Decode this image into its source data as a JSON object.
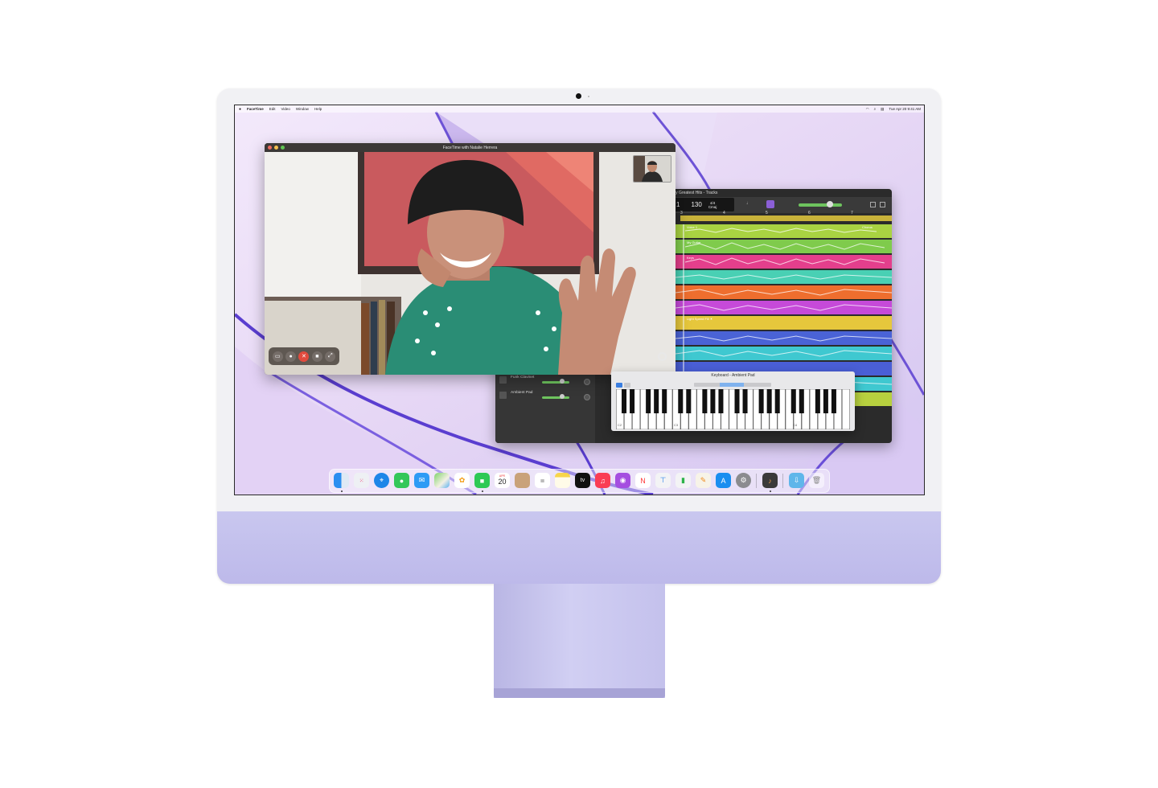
{
  "menubar": {
    "apple": "",
    "items": [
      "FaceTime",
      "Edit",
      "Video",
      "Window",
      "Help"
    ],
    "datetime": "Tue Apr 20  9:41 AM"
  },
  "facetime": {
    "title": "FaceTime with Natalie Herrera"
  },
  "garageband": {
    "title": "My Greatest Hits - Tracks",
    "lcd": {
      "bar": "1",
      "tempo": "130",
      "signature": "4/4",
      "key": "Cmaj"
    },
    "ruler": [
      "3",
      "4",
      "5",
      "6",
      "7"
    ],
    "track_labels": {
      "vocal": "Voice 1",
      "guitar": "My Guitar",
      "keys": "Keys",
      "light": "Light Speed Fill ☀",
      "chorus": "Chorus"
    },
    "tracks": [
      "Funk Clavinet",
      "Ambient Pad"
    ]
  },
  "keyboard": {
    "title": "Keyboard - Ambient Pad",
    "octaves": [
      "C2",
      "C3",
      "C4"
    ]
  },
  "calendar": {
    "month": "APR",
    "day": "20"
  },
  "appletv": "tv",
  "colors": {
    "track_colors": [
      "#a9d342",
      "#7fcb4c",
      "#5fce6a",
      "#e43f8c",
      "#49d0b4",
      "#ee6e2e",
      "#c64ad9",
      "#e6c73c",
      "#4a63d6",
      "#3fc8d0",
      "#4a5fd6",
      "#b7d03f"
    ]
  }
}
